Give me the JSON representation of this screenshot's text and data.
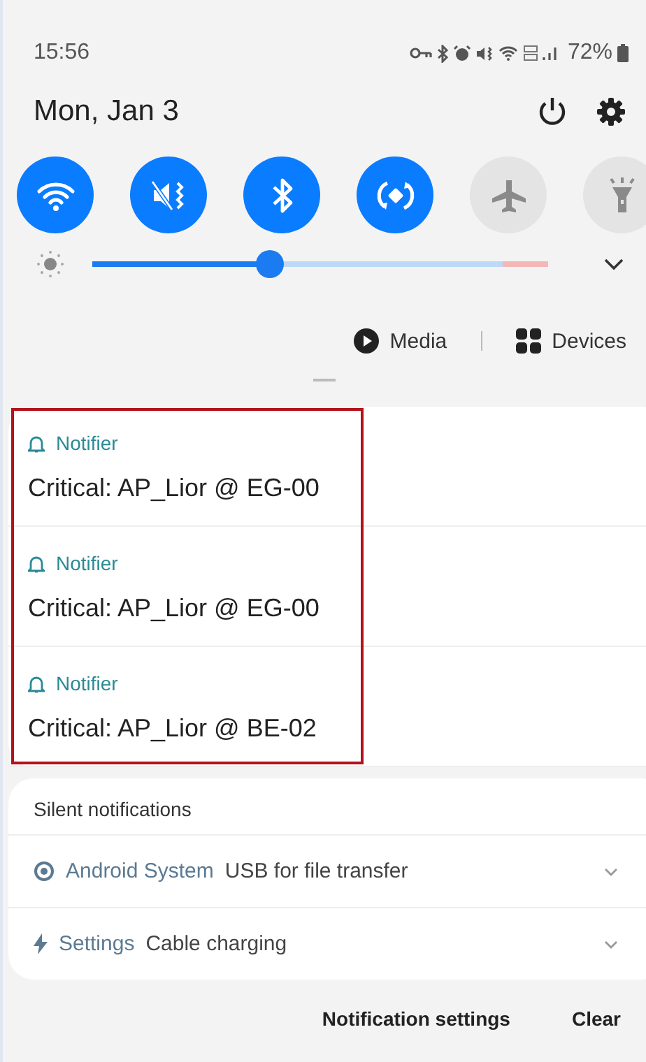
{
  "status_bar": {
    "time": "15:56",
    "battery": "72%"
  },
  "header": {
    "date": "Mon, Jan 3"
  },
  "quick_tiles": [
    {
      "kind": "wifi",
      "on": true
    },
    {
      "kind": "mute",
      "on": true
    },
    {
      "kind": "bluetooth",
      "on": true
    },
    {
      "kind": "rotate",
      "on": true
    },
    {
      "kind": "airplane",
      "on": false
    },
    {
      "kind": "flashlight",
      "on": false
    }
  ],
  "brightness": {
    "level": 0.39
  },
  "media_bar": {
    "media": "Media",
    "devices": "Devices"
  },
  "notifications": [
    {
      "app": "Notifier",
      "title": "Critical: AP_Lior @ EG-00"
    },
    {
      "app": "Notifier",
      "title": "Critical: AP_Lior @ EG-00"
    },
    {
      "app": "Notifier",
      "title": "Critical: AP_Lior @ BE-02"
    }
  ],
  "silent": {
    "heading": "Silent notifications",
    "items": [
      {
        "kind": "system",
        "app": "Android System",
        "text": "USB for file transfer"
      },
      {
        "kind": "charging",
        "app": "Settings",
        "text": "Cable charging"
      }
    ]
  },
  "footer": {
    "buttons": [
      "Notification settings",
      "Clear"
    ]
  }
}
